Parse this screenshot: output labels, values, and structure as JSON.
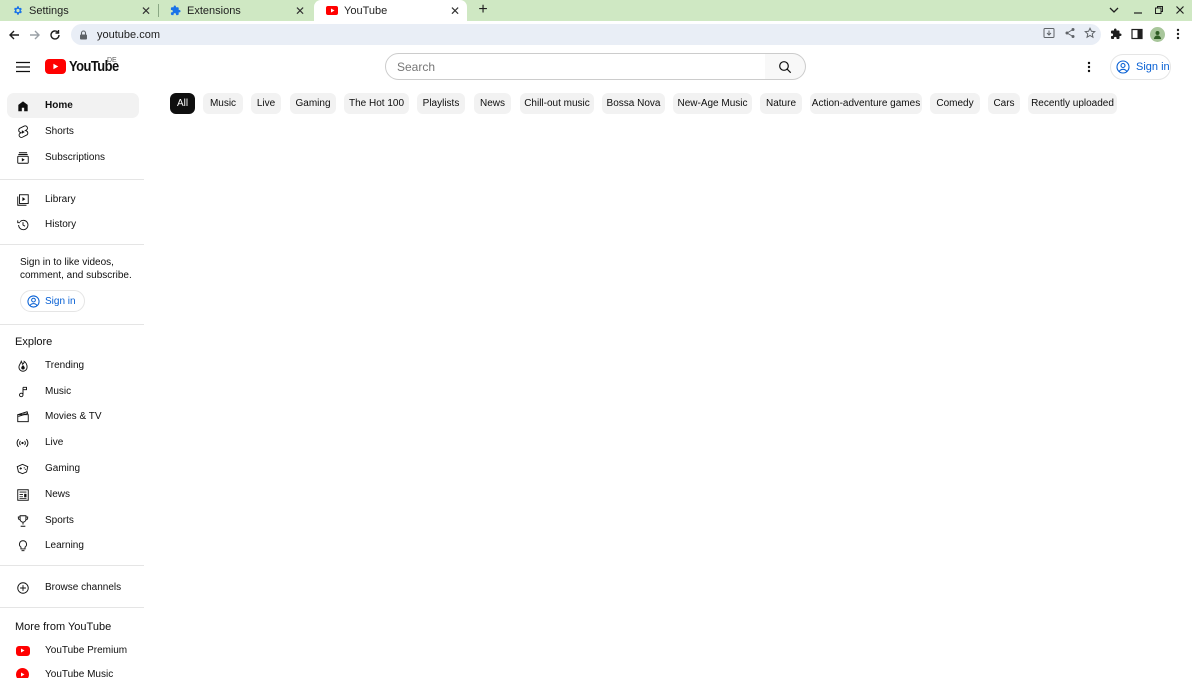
{
  "browser": {
    "tabs": [
      {
        "title": "Settings",
        "icon": "gear-icon"
      },
      {
        "title": "Extensions",
        "icon": "puzzle-icon"
      },
      {
        "title": "YouTube",
        "icon": "youtube-icon"
      }
    ],
    "url": "youtube.com"
  },
  "masthead": {
    "logo_text": "YouTube",
    "country_code": "DE",
    "search_placeholder": "Search",
    "sign_in_label": "Sign in"
  },
  "chips": [
    "All",
    "Music",
    "Live",
    "Gaming",
    "The Hot 100",
    "Playlists",
    "News",
    "Chill-out music",
    "Bossa Nova",
    "New-Age Music",
    "Nature",
    "Action-adventure games",
    "Comedy",
    "Cars",
    "Recently uploaded"
  ],
  "sidebar": {
    "main": [
      {
        "label": "Home",
        "icon": "home-icon"
      },
      {
        "label": "Shorts",
        "icon": "shorts-icon"
      },
      {
        "label": "Subscriptions",
        "icon": "subscriptions-icon"
      }
    ],
    "library": [
      {
        "label": "Library",
        "icon": "library-icon"
      },
      {
        "label": "History",
        "icon": "history-icon"
      }
    ],
    "signin_prompt": "Sign in to like videos, comment, and subscribe.",
    "signin_label": "Sign in",
    "explore_heading": "Explore",
    "explore": [
      {
        "label": "Trending",
        "icon": "trending-icon"
      },
      {
        "label": "Music",
        "icon": "music-icon"
      },
      {
        "label": "Movies & TV",
        "icon": "movies-icon"
      },
      {
        "label": "Live",
        "icon": "live-icon"
      },
      {
        "label": "Gaming",
        "icon": "gaming-icon"
      },
      {
        "label": "News",
        "icon": "news-icon"
      },
      {
        "label": "Sports",
        "icon": "sports-icon"
      },
      {
        "label": "Learning",
        "icon": "learning-icon"
      }
    ],
    "browse_channels": "Browse channels",
    "more_heading": "More from YouTube",
    "more": [
      {
        "label": "YouTube Premium",
        "icon": "youtube-premium-icon"
      },
      {
        "label": "YouTube Music",
        "icon": "youtube-music-icon"
      }
    ]
  },
  "colors": {
    "tabstrip": "#cfe8c3",
    "youtube_red": "#ff0000",
    "link_blue": "#065fd4",
    "chip_bg": "#f2f2f2",
    "chip_active": "#0f0f0f"
  }
}
